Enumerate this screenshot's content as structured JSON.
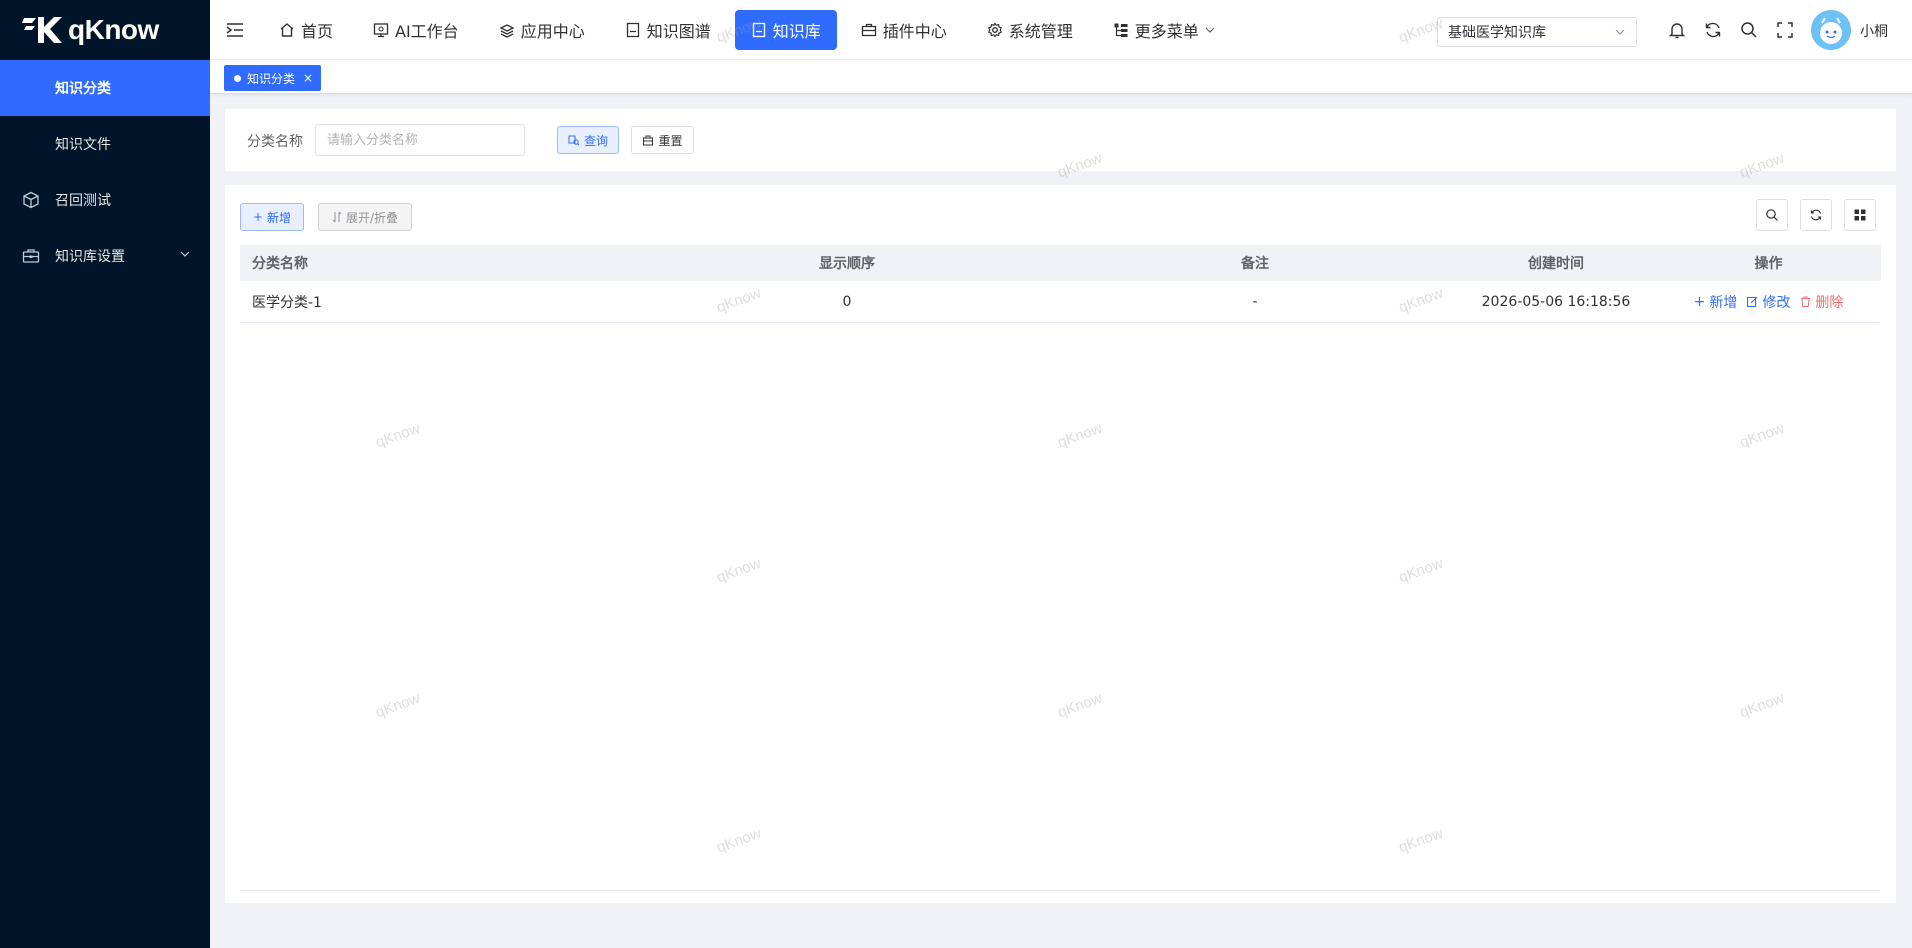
{
  "brand": {
    "name": "qKnow"
  },
  "sidebar": {
    "items": [
      {
        "label": "知识分类",
        "icon": "none",
        "active": true
      },
      {
        "label": "知识文件",
        "icon": "none",
        "active": false
      },
      {
        "label": "召回测试",
        "icon": "cube-icon",
        "active": false
      },
      {
        "label": "知识库设置",
        "icon": "toolbox-icon",
        "active": false,
        "expandable": true
      }
    ]
  },
  "topnav": {
    "items": [
      {
        "label": "首页",
        "icon": "home-icon"
      },
      {
        "label": "AI工作台",
        "icon": "monitor-icon"
      },
      {
        "label": "应用中心",
        "icon": "layers-icon"
      },
      {
        "label": "知识图谱",
        "icon": "book-icon"
      },
      {
        "label": "知识库",
        "icon": "book-icon",
        "active": true
      },
      {
        "label": "插件中心",
        "icon": "briefcase-icon"
      },
      {
        "label": "系统管理",
        "icon": "gear-icon"
      },
      {
        "label": "更多菜单",
        "icon": "tree-icon",
        "dropdown": true
      }
    ],
    "kb_select": "基础医学知识库",
    "username": "小桐"
  },
  "tags": [
    {
      "label": "知识分类",
      "active": true
    }
  ],
  "search": {
    "label": "分类名称",
    "placeholder": "请输入分类名称",
    "query_label": "查询",
    "reset_label": "重置"
  },
  "toolbar": {
    "add_label": "新增",
    "expand_label": "展开/折叠"
  },
  "table": {
    "columns": [
      "分类名称",
      "显示顺序",
      "备注",
      "创建时间",
      "操作"
    ],
    "rows": [
      {
        "name": "医学分类-1",
        "order": "0",
        "remark": "-",
        "created": "2026-05-06 16:18:56"
      }
    ],
    "ops": {
      "add": "新增",
      "edit": "修改",
      "delete": "删除"
    }
  },
  "watermark": "qKnow",
  "colors": {
    "primary": "#2f6bff",
    "sidebar_bg": "#001529",
    "danger": "#f56c6c"
  }
}
